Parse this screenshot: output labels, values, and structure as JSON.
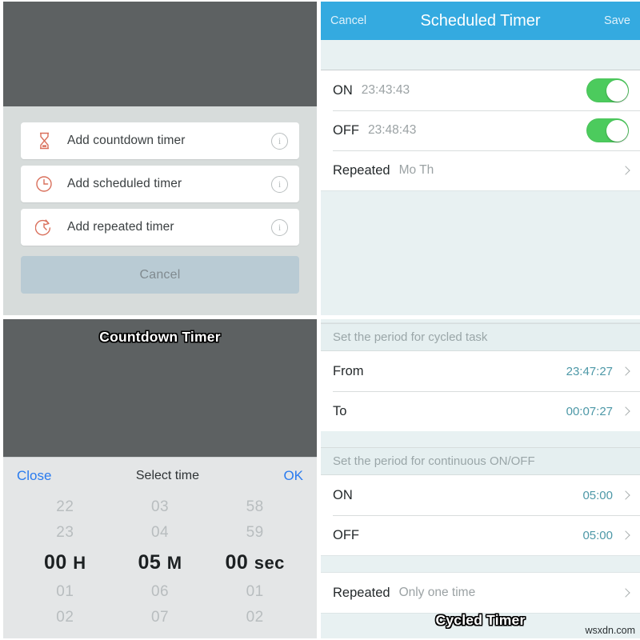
{
  "panels": {
    "action_sheet": {
      "options": [
        {
          "icon": "hourglass-icon",
          "label": "Add countdown timer",
          "info": "i"
        },
        {
          "icon": "clock-icon",
          "label": "Add scheduled timer",
          "info": "i"
        },
        {
          "icon": "repeat-clock-icon",
          "label": "Add repeated timer",
          "info": "i"
        }
      ],
      "cancel_label": "Cancel"
    },
    "scheduled_timer": {
      "header": {
        "cancel": "Cancel",
        "title": "Scheduled Timer",
        "save": "Save"
      },
      "rows": [
        {
          "key": "ON",
          "value": "23:43:43",
          "toggle": "on"
        },
        {
          "key": "OFF",
          "value": "23:48:43",
          "toggle": "on"
        }
      ],
      "repeated": {
        "key": "Repeated",
        "value": "Mo  Th"
      }
    },
    "countdown_timer": {
      "caption": "Countdown Timer",
      "picker": {
        "close_label": "Close",
        "title": "Select time",
        "ok_label": "OK",
        "columns": [
          {
            "above": [
              "22",
              "23"
            ],
            "selected": "00",
            "unit": "H",
            "below": [
              "01",
              "02"
            ]
          },
          {
            "above": [
              "03",
              "04"
            ],
            "selected": "05",
            "unit": "M",
            "below": [
              "06",
              "07"
            ]
          },
          {
            "above": [
              "58",
              "59"
            ],
            "selected": "00",
            "unit": "sec",
            "below": [
              "01",
              "02"
            ]
          }
        ]
      }
    },
    "cycled_timer": {
      "caption": "Cycled Timer",
      "watermark": "wsxdn.com",
      "section_cycled": "Set the period for cycled task",
      "cycled_rows": [
        {
          "key": "From",
          "value": "23:47:27"
        },
        {
          "key": "To",
          "value": "00:07:27"
        }
      ],
      "section_continuous": "Set the period for continuous ON/OFF",
      "continuous_rows": [
        {
          "key": "ON",
          "value": "05:00"
        },
        {
          "key": "OFF",
          "value": "05:00"
        }
      ],
      "repeated": {
        "key": "Repeated",
        "value": "Only one time"
      }
    }
  },
  "colors": {
    "header_blue": "#34aae0",
    "toggle_green": "#4ccb5d",
    "accent_orange": "#d9705c",
    "link_blue": "#2a7bef",
    "value_teal": "#4d98a7",
    "panel_tint": "#e8f1f2",
    "dim_gray": "#5d6162"
  }
}
